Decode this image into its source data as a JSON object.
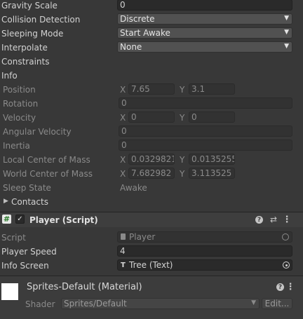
{
  "rigidbody": {
    "gravity_scale": {
      "label": "Gravity Scale",
      "value": "0"
    },
    "collision_detection": {
      "label": "Collision Detection",
      "value": "Discrete"
    },
    "sleeping_mode": {
      "label": "Sleeping Mode",
      "value": "Start Awake"
    },
    "interpolate": {
      "label": "Interpolate",
      "value": "None"
    },
    "constraints_label": "Constraints",
    "info": {
      "label": "Info",
      "position": {
        "label": "Position",
        "x_axis": "X",
        "x": "7.65",
        "y_axis": "Y",
        "y": "3.1"
      },
      "rotation": {
        "label": "Rotation",
        "value": "0"
      },
      "velocity": {
        "label": "Velocity",
        "x_axis": "X",
        "x": "0",
        "y_axis": "Y",
        "y": "0"
      },
      "angular_velocity": {
        "label": "Angular Velocity",
        "value": "0"
      },
      "inertia": {
        "label": "Inertia",
        "value": "0"
      },
      "local_center_of_mass": {
        "label": "Local Center of Mass",
        "x_axis": "X",
        "x": "0.0329821",
        "y_axis": "Y",
        "y": "0.0135255"
      },
      "world_center_of_mass": {
        "label": "World Center of Mass",
        "x_axis": "X",
        "x": "7.682982",
        "y_axis": "Y",
        "y": "3.113525"
      },
      "sleep_state": {
        "label": "Sleep State",
        "value": "Awake"
      },
      "contacts": {
        "label": "Contacts"
      }
    }
  },
  "player_script": {
    "title": "Player (Script)",
    "script": {
      "label": "Script",
      "value": "Player"
    },
    "player_speed": {
      "label": "Player Speed",
      "value": "4"
    },
    "info_screen": {
      "label": "Info Screen",
      "value": "Tree (Text)"
    }
  },
  "material": {
    "title": "Sprites-Default (Material)",
    "shader": {
      "label": "Shader",
      "value": "Sprites/Default",
      "edit_label": "Edit..."
    }
  },
  "colors": {
    "background": "#383838",
    "field": "#2a2a2a",
    "dropdown": "#515151",
    "text": "#d2d2d2",
    "dim_text": "#8a8a8a"
  }
}
